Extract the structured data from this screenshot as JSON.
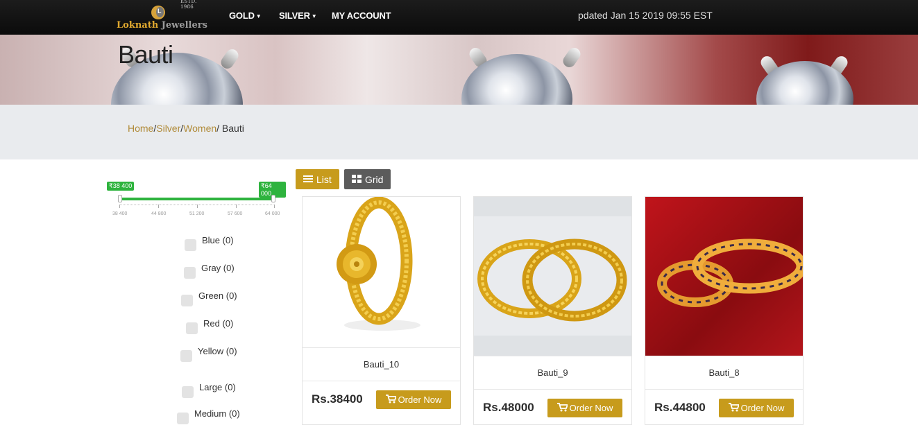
{
  "brand": {
    "estd": "ESTD. 1986",
    "name_first": "Loknath",
    "name_second": "Jewellers"
  },
  "nav": {
    "items": [
      {
        "label": "GOLD",
        "dropdown": true
      },
      {
        "label": "SILVER",
        "dropdown": true
      },
      {
        "label": "MY ACCOUNT",
        "dropdown": false
      }
    ],
    "ticker": "pdated Jan 15 2019 09:55 EST"
  },
  "banner": {
    "title": "Bauti"
  },
  "breadcrumb": {
    "home": "Home",
    "silver": "Silver",
    "women": "Women",
    "current": " Bauti"
  },
  "price_filter": {
    "min_label": "₹38 400",
    "max_label": "₹64 000",
    "scale": [
      "38 400",
      "44 800",
      "51 200",
      "57 600",
      "64 000"
    ]
  },
  "filters": [
    {
      "label": "Blue (0)"
    },
    {
      "label": "Gray (0)"
    },
    {
      "label": "Green (0)"
    },
    {
      "label": "Red (0)"
    },
    {
      "label": "Yellow (0)"
    },
    {
      "label": "Large (0)"
    },
    {
      "label": "Medium (0)"
    }
  ],
  "view": {
    "list_label": "List",
    "grid_label": "Grid"
  },
  "products": [
    {
      "name": "Bauti_10",
      "price": "Rs.38400",
      "button": "Order Now"
    },
    {
      "name": "Bauti_9",
      "price": "Rs.48000",
      "button": "Order Now"
    },
    {
      "name": "Bauti_8",
      "price": "Rs.44800",
      "button": "Order Now"
    }
  ],
  "colors": {
    "accent": "#c79b1c",
    "range_green": "#2eb33e",
    "nav_bg": "#111111",
    "link": "#b08a37"
  },
  "icons": {
    "list": "list-icon",
    "grid": "grid-icon",
    "cart": "cart-icon",
    "chevron": "chevron-down-icon"
  }
}
